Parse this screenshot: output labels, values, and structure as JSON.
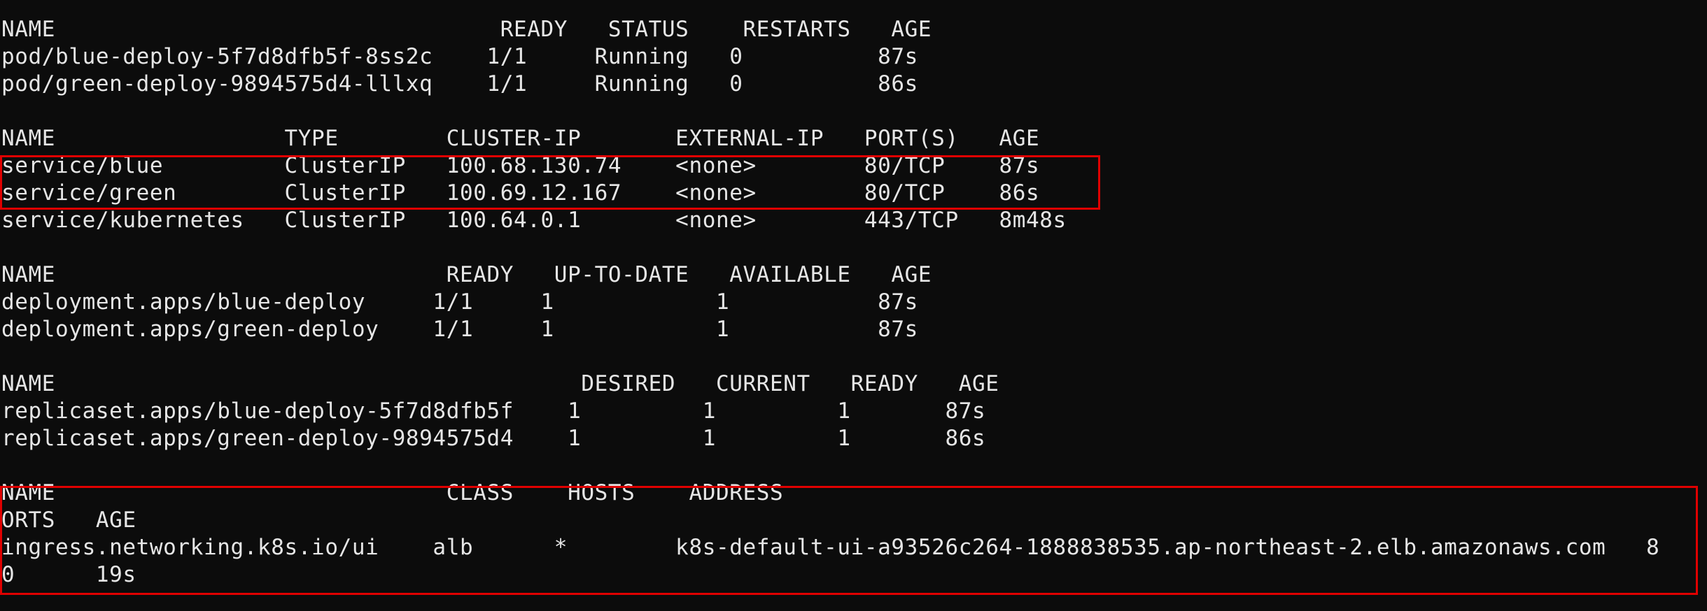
{
  "terminal": {
    "lines": [
      "NAME                                 READY   STATUS    RESTARTS   AGE",
      "pod/blue-deploy-5f7d8dfb5f-8ss2c    1/1     Running   0          87s",
      "pod/green-deploy-9894575d4-lllxq    1/1     Running   0          86s",
      "",
      "NAME                 TYPE        CLUSTER-IP       EXTERNAL-IP   PORT(S)   AGE",
      "service/blue         ClusterIP   100.68.130.74    <none>        80/TCP    87s",
      "service/green        ClusterIP   100.69.12.167    <none>        80/TCP    86s",
      "service/kubernetes   ClusterIP   100.64.0.1       <none>        443/TCP   8m48s",
      "",
      "NAME                             READY   UP-TO-DATE   AVAILABLE   AGE",
      "deployment.apps/blue-deploy     1/1     1            1           87s",
      "deployment.apps/green-deploy    1/1     1            1           87s",
      "",
      "NAME                                       DESIRED   CURRENT   READY   AGE",
      "replicaset.apps/blue-deploy-5f7d8dfb5f    1         1         1       87s",
      "replicaset.apps/green-deploy-9894575d4    1         1         1       86s",
      "",
      "NAME                             CLASS    HOSTS    ADDRESS                                                                     P",
      "ORTS   AGE",
      "ingress.networking.k8s.io/ui    alb      *        k8s-default-ui-a93526c264-1888838535.ap-northeast-2.elb.amazonaws.com   8",
      "0      19s"
    ]
  },
  "highlight_color": "#e00000"
}
